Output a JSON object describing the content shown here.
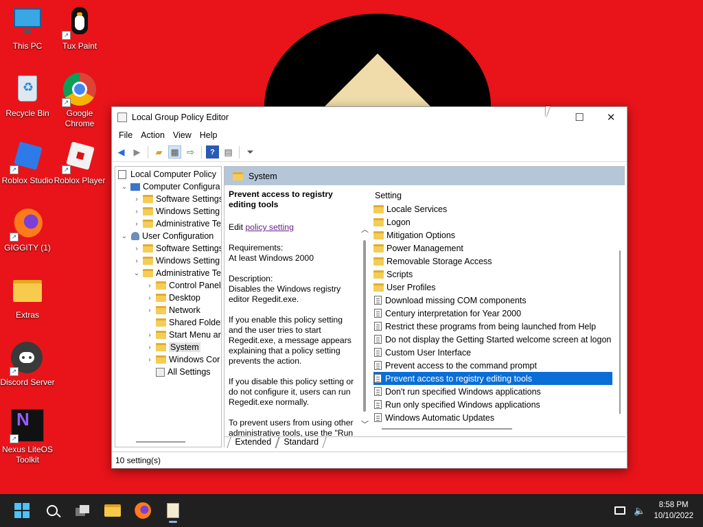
{
  "desktop": {
    "icons": [
      {
        "label": "This PC"
      },
      {
        "label": "Tux Paint"
      },
      {
        "label": "Recycle Bin"
      },
      {
        "label": "Google Chrome"
      },
      {
        "label": "Roblox Studio"
      },
      {
        "label": "Roblox Player"
      },
      {
        "label": "GIGGITY (1)"
      },
      {
        "label": "Extras"
      },
      {
        "label": "Discord Server"
      },
      {
        "label": "Nexus LiteOS Toolkit"
      }
    ]
  },
  "window": {
    "title": "Local Group Policy Editor",
    "menu": [
      "File",
      "Action",
      "View",
      "Help"
    ],
    "tree": [
      {
        "label": "Local Computer Policy"
      },
      {
        "label": "Computer Configura"
      },
      {
        "label": "Software Settings"
      },
      {
        "label": "Windows Setting"
      },
      {
        "label": "Administrative Te"
      },
      {
        "label": "User Configuration"
      },
      {
        "label": "Software Settings"
      },
      {
        "label": "Windows Setting"
      },
      {
        "label": "Administrative Te"
      },
      {
        "label": "Control Panel"
      },
      {
        "label": "Desktop"
      },
      {
        "label": "Network"
      },
      {
        "label": "Shared Folder"
      },
      {
        "label": "Start Menu ar"
      },
      {
        "label": "System"
      },
      {
        "label": "Windows Cor"
      },
      {
        "label": "All Settings"
      }
    ],
    "header": "System",
    "desc": {
      "title": "Prevent access to registry editing tools",
      "edit_prefix": "Edit ",
      "edit_link": "policy setting",
      "req_label": "Requirements:",
      "req_value": "At least Windows 2000",
      "desc_label": "Description:",
      "desc_value": "Disables the Windows registry editor Regedit.exe.",
      "p1": "If you enable this policy setting and the user tries to start Regedit.exe, a message appears explaining that a policy setting prevents the action.",
      "p2": "If you disable this policy setting or do not configure it, users can run Regedit.exe normally.",
      "p3": "To prevent users from using other administrative tools, use the \"Run"
    },
    "list_header": "Setting",
    "list": [
      {
        "label": "Locale Services",
        "kind": "folder"
      },
      {
        "label": "Logon",
        "kind": "folder"
      },
      {
        "label": "Mitigation Options",
        "kind": "folder"
      },
      {
        "label": "Power Management",
        "kind": "folder"
      },
      {
        "label": "Removable Storage Access",
        "kind": "folder"
      },
      {
        "label": "Scripts",
        "kind": "folder"
      },
      {
        "label": "User Profiles",
        "kind": "folder"
      },
      {
        "label": "Download missing COM components",
        "kind": "policy"
      },
      {
        "label": "Century interpretation for Year 2000",
        "kind": "policy"
      },
      {
        "label": "Restrict these programs from being launched from Help",
        "kind": "policy"
      },
      {
        "label": "Do not display the Getting Started welcome screen at logon",
        "kind": "policy"
      },
      {
        "label": "Custom User Interface",
        "kind": "policy"
      },
      {
        "label": "Prevent access to the command prompt",
        "kind": "policy"
      },
      {
        "label": "Prevent access to registry editing tools",
        "kind": "policy",
        "selected": true
      },
      {
        "label": "Don't run specified Windows applications",
        "kind": "policy"
      },
      {
        "label": "Run only specified Windows applications",
        "kind": "policy"
      },
      {
        "label": "Windows Automatic Updates",
        "kind": "policy"
      }
    ],
    "tabs": [
      "Extended",
      "Standard"
    ],
    "status": "10 setting(s)"
  },
  "taskbar": {
    "time": "8:58 PM",
    "date": "10/10/2022"
  },
  "colors": {
    "desktop": "#e8141a",
    "selection": "#0a6ed6",
    "header": "#b5c6d8"
  }
}
